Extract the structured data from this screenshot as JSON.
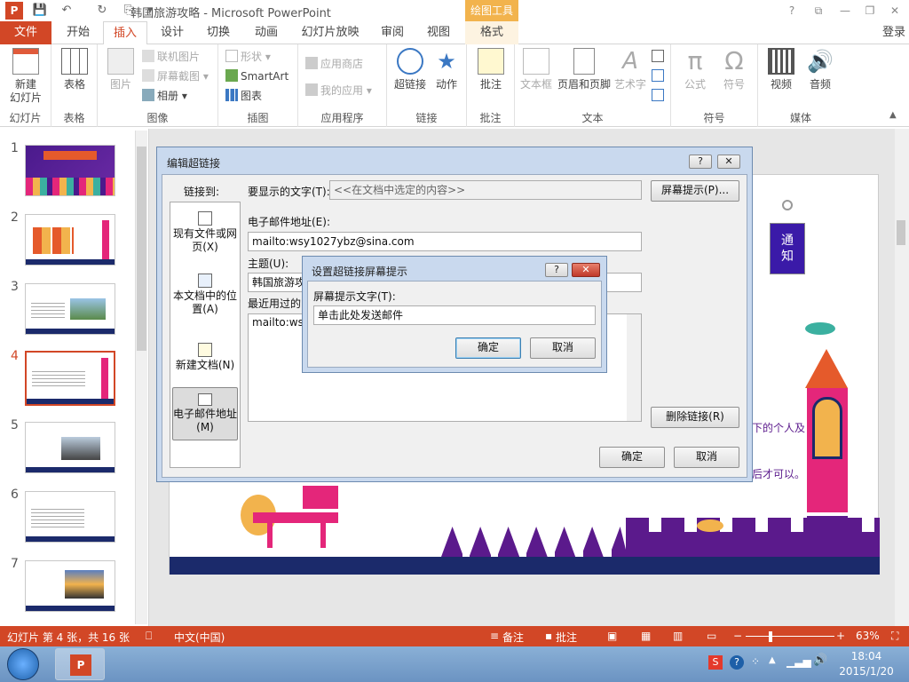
{
  "window": {
    "title": "韩国旅游攻略 - Microsoft PowerPoint",
    "context_tab": "绘图工具",
    "signin": "登录"
  },
  "tabs": [
    "文件",
    "开始",
    "插入",
    "设计",
    "切换",
    "动画",
    "幻灯片放映",
    "审阅",
    "视图",
    "格式"
  ],
  "ribbon": {
    "groups": {
      "slides": "幻灯片",
      "tables": "表格",
      "images": "图像",
      "illustrations": "插图",
      "apps": "应用程序",
      "links": "链接",
      "comments": "批注",
      "text": "文本",
      "symbols": "符号",
      "media": "媒体"
    },
    "new_slide": "新建\n幻灯片",
    "table": "表格",
    "picture": "图片",
    "online_pictures": "联机图片",
    "screenshot": "屏幕截图",
    "album": "相册",
    "shapes": "形状",
    "smartart": "SmartArt",
    "chart": "图表",
    "store": "应用商店",
    "my_apps": "我的应用",
    "hyperlink": "超链接",
    "action": "动作",
    "comment": "批注",
    "textbox": "文本框",
    "header_footer": "页眉和页脚",
    "wordart": "艺术字",
    "equation": "公式",
    "symbol": "符号",
    "video": "视频",
    "audio": "音频"
  },
  "thumbnails": [
    "1",
    "2",
    "3",
    "4",
    "5",
    "6",
    "7"
  ],
  "slide": {
    "callout_text": "通\n知",
    "text_right1": "下的个人及",
    "text_right2": "后才可以。"
  },
  "hyperlink_dialog": {
    "title": "编辑超链接",
    "link_to": "链接到:",
    "display_text_label": "要显示的文字(T):",
    "display_text_value": "<<在文档中选定的内容>>",
    "screentip_button": "屏幕提示(P)...",
    "nav": [
      "现有文件或网页(X)",
      "本文档中的位置(A)",
      "新建文档(N)",
      "电子邮件地址(M)"
    ],
    "email_label": "电子邮件地址(E):",
    "email_value": "mailto:wsy1027ybz@sina.com",
    "subject_label": "主题(U):",
    "subject_value": "韩国旅游攻",
    "recent_label": "最近用过的",
    "recent_value": "mailto:wsy",
    "remove_link": "删除链接(R)",
    "ok": "确定",
    "cancel": "取消",
    "help": "?",
    "close": "✕"
  },
  "screentip_dialog": {
    "title": "设置超链接屏幕提示",
    "label": "屏幕提示文字(T):",
    "value": "单击此处发送邮件",
    "ok": "确定",
    "cancel": "取消",
    "help": "?",
    "close": "✕"
  },
  "status": {
    "slide_info": "幻灯片 第 4 张，共 16 张",
    "language": "中文(中国)",
    "notes": "备注",
    "comments": "批注",
    "zoom": "63%"
  },
  "taskbar": {
    "time": "18:04",
    "date": "2015/1/20"
  },
  "colors": {
    "accent": "#d24726",
    "context": "#f2b34d",
    "purple": "#5b1a8c",
    "pink": "#e4267a",
    "navy": "#1b2a6b"
  }
}
